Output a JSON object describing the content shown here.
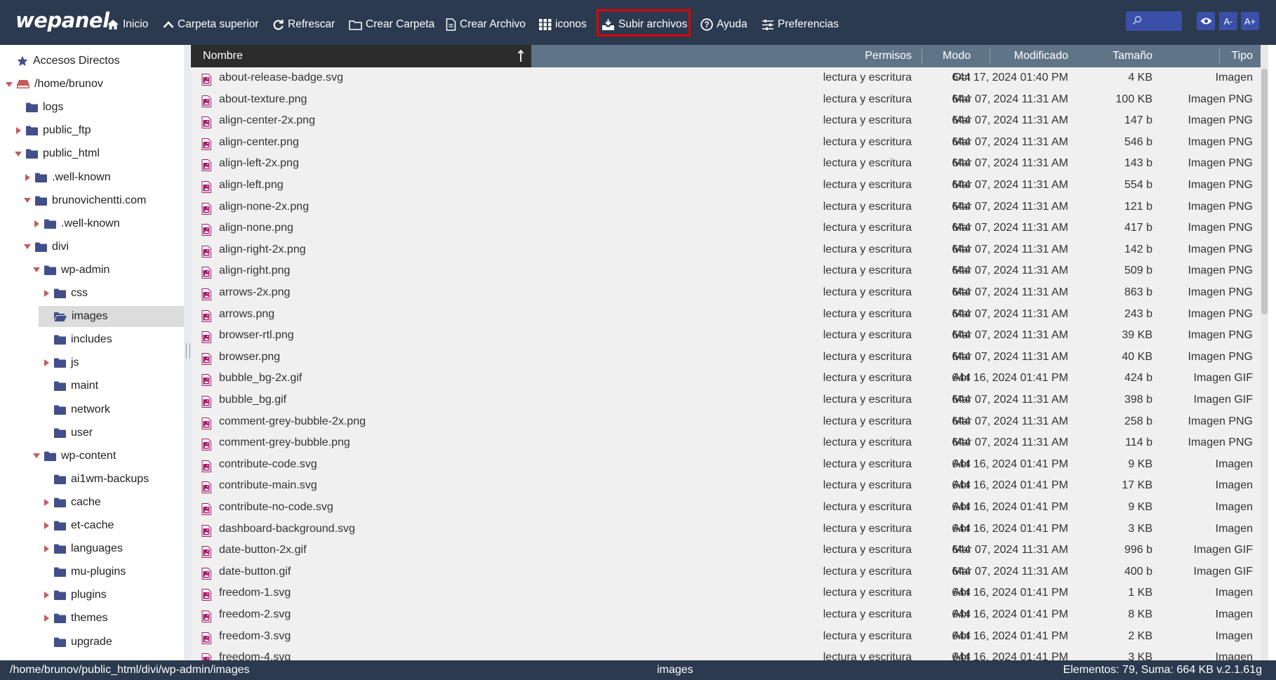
{
  "toolbar": {
    "logo": "wepanel",
    "buttons": [
      {
        "label": "Inicio",
        "icon": "home-icon"
      },
      {
        "label": "Carpeta superior",
        "icon": "chevron-up-icon"
      },
      {
        "label": "Refrescar",
        "icon": "refresh-icon"
      },
      {
        "label": "Crear Carpeta",
        "icon": "new-folder-icon"
      },
      {
        "label": "Crear Archivo",
        "icon": "new-file-icon"
      },
      {
        "label": "iconos",
        "icon": "grid-icon"
      },
      {
        "label": "Subir archivos",
        "icon": "upload-icon",
        "highlighted": true
      },
      {
        "label": "Ayuda",
        "icon": "help-icon"
      },
      {
        "label": "Preferencias",
        "icon": "sliders-icon"
      }
    ],
    "search_placeholder": "",
    "font_decrease": "A-",
    "font_increase": "A+",
    "highlight_color": "#e00000",
    "accent_color": "#3a4fa8"
  },
  "sidebar": {
    "items": [
      {
        "label": "Accesos Directos",
        "icon": "star-icon",
        "caret": "none",
        "depth": 0
      },
      {
        "label": "/home/brunov",
        "icon": "drive-icon",
        "caret": "down",
        "depth": 0
      },
      {
        "label": "logs",
        "icon": "folder-icon",
        "caret": "none",
        "depth": 1
      },
      {
        "label": "public_ftp",
        "icon": "folder-icon",
        "caret": "right",
        "depth": 1
      },
      {
        "label": "public_html",
        "icon": "folder-icon",
        "caret": "down",
        "depth": 1
      },
      {
        "label": ".well-known",
        "icon": "folder-icon",
        "caret": "right",
        "depth": 2
      },
      {
        "label": "brunovichentti.com",
        "icon": "folder-icon",
        "caret": "down",
        "depth": 2
      },
      {
        "label": ".well-known",
        "icon": "folder-icon",
        "caret": "right",
        "depth": 3
      },
      {
        "label": "divi",
        "icon": "folder-icon",
        "caret": "down",
        "depth": 2
      },
      {
        "label": "wp-admin",
        "icon": "folder-icon",
        "caret": "down",
        "depth": 3
      },
      {
        "label": "css",
        "icon": "folder-icon",
        "caret": "right",
        "depth": 4
      },
      {
        "label": "images",
        "icon": "open-folder-icon",
        "caret": "none",
        "depth": 4,
        "selected": true
      },
      {
        "label": "includes",
        "icon": "folder-icon",
        "caret": "none",
        "depth": 4
      },
      {
        "label": "js",
        "icon": "folder-icon",
        "caret": "right",
        "depth": 4
      },
      {
        "label": "maint",
        "icon": "folder-icon",
        "caret": "none",
        "depth": 4
      },
      {
        "label": "network",
        "icon": "folder-icon",
        "caret": "none",
        "depth": 4
      },
      {
        "label": "user",
        "icon": "folder-icon",
        "caret": "none",
        "depth": 4
      },
      {
        "label": "wp-content",
        "icon": "folder-icon",
        "caret": "down",
        "depth": 3
      },
      {
        "label": "ai1wm-backups",
        "icon": "folder-icon",
        "caret": "none",
        "depth": 4
      },
      {
        "label": "cache",
        "icon": "folder-icon",
        "caret": "right",
        "depth": 4
      },
      {
        "label": "et-cache",
        "icon": "folder-icon",
        "caret": "right",
        "depth": 4
      },
      {
        "label": "languages",
        "icon": "folder-icon",
        "caret": "right",
        "depth": 4
      },
      {
        "label": "mu-plugins",
        "icon": "folder-icon",
        "caret": "none",
        "depth": 4
      },
      {
        "label": "plugins",
        "icon": "folder-icon",
        "caret": "right",
        "depth": 4
      },
      {
        "label": "themes",
        "icon": "folder-icon",
        "caret": "right",
        "depth": 4
      },
      {
        "label": "upgrade",
        "icon": "folder-icon",
        "caret": "none",
        "depth": 4
      }
    ]
  },
  "table": {
    "columns": {
      "name": "Nombre",
      "perms": "Permisos",
      "mode": "Modo",
      "modified": "Modificado",
      "size": "Tamaño",
      "type": "Tipo"
    },
    "sort_icon": "sort-asc-icon",
    "rows": [
      {
        "name": "about-release-badge.svg",
        "perms": "lectura y escritura",
        "mode": "644",
        "modified": "Oct 17, 2024 01:40 PM",
        "size": "4 KB",
        "type": "Imagen"
      },
      {
        "name": "about-texture.png",
        "perms": "lectura y escritura",
        "mode": "644",
        "modified": "Mar 07, 2024 11:31 AM",
        "size": "100 KB",
        "type": "Imagen PNG"
      },
      {
        "name": "align-center-2x.png",
        "perms": "lectura y escritura",
        "mode": "644",
        "modified": "Mar 07, 2024 11:31 AM",
        "size": "147 b",
        "type": "Imagen PNG"
      },
      {
        "name": "align-center.png",
        "perms": "lectura y escritura",
        "mode": "644",
        "modified": "Mar 07, 2024 11:31 AM",
        "size": "546 b",
        "type": "Imagen PNG"
      },
      {
        "name": "align-left-2x.png",
        "perms": "lectura y escritura",
        "mode": "644",
        "modified": "Mar 07, 2024 11:31 AM",
        "size": "143 b",
        "type": "Imagen PNG"
      },
      {
        "name": "align-left.png",
        "perms": "lectura y escritura",
        "mode": "644",
        "modified": "Mar 07, 2024 11:31 AM",
        "size": "554 b",
        "type": "Imagen PNG"
      },
      {
        "name": "align-none-2x.png",
        "perms": "lectura y escritura",
        "mode": "644",
        "modified": "Mar 07, 2024 11:31 AM",
        "size": "121 b",
        "type": "Imagen PNG"
      },
      {
        "name": "align-none.png",
        "perms": "lectura y escritura",
        "mode": "644",
        "modified": "Mar 07, 2024 11:31 AM",
        "size": "417 b",
        "type": "Imagen PNG"
      },
      {
        "name": "align-right-2x.png",
        "perms": "lectura y escritura",
        "mode": "644",
        "modified": "Mar 07, 2024 11:31 AM",
        "size": "142 b",
        "type": "Imagen PNG"
      },
      {
        "name": "align-right.png",
        "perms": "lectura y escritura",
        "mode": "644",
        "modified": "Mar 07, 2024 11:31 AM",
        "size": "509 b",
        "type": "Imagen PNG"
      },
      {
        "name": "arrows-2x.png",
        "perms": "lectura y escritura",
        "mode": "644",
        "modified": "Mar 07, 2024 11:31 AM",
        "size": "863 b",
        "type": "Imagen PNG"
      },
      {
        "name": "arrows.png",
        "perms": "lectura y escritura",
        "mode": "644",
        "modified": "Mar 07, 2024 11:31 AM",
        "size": "243 b",
        "type": "Imagen PNG"
      },
      {
        "name": "browser-rtl.png",
        "perms": "lectura y escritura",
        "mode": "644",
        "modified": "Mar 07, 2024 11:31 AM",
        "size": "39 KB",
        "type": "Imagen PNG"
      },
      {
        "name": "browser.png",
        "perms": "lectura y escritura",
        "mode": "644",
        "modified": "Mar 07, 2024 11:31 AM",
        "size": "40 KB",
        "type": "Imagen PNG"
      },
      {
        "name": "bubble_bg-2x.gif",
        "perms": "lectura y escritura",
        "mode": "644",
        "modified": "Abr 16, 2024 01:41 PM",
        "size": "424 b",
        "type": "Imagen GIF"
      },
      {
        "name": "bubble_bg.gif",
        "perms": "lectura y escritura",
        "mode": "644",
        "modified": "Mar 07, 2024 11:31 AM",
        "size": "398 b",
        "type": "Imagen GIF"
      },
      {
        "name": "comment-grey-bubble-2x.png",
        "perms": "lectura y escritura",
        "mode": "644",
        "modified": "Mar 07, 2024 11:31 AM",
        "size": "258 b",
        "type": "Imagen PNG"
      },
      {
        "name": "comment-grey-bubble.png",
        "perms": "lectura y escritura",
        "mode": "644",
        "modified": "Mar 07, 2024 11:31 AM",
        "size": "114 b",
        "type": "Imagen PNG"
      },
      {
        "name": "contribute-code.svg",
        "perms": "lectura y escritura",
        "mode": "644",
        "modified": "Abr 16, 2024 01:41 PM",
        "size": "9 KB",
        "type": "Imagen"
      },
      {
        "name": "contribute-main.svg",
        "perms": "lectura y escritura",
        "mode": "644",
        "modified": "Abr 16, 2024 01:41 PM",
        "size": "17 KB",
        "type": "Imagen"
      },
      {
        "name": "contribute-no-code.svg",
        "perms": "lectura y escritura",
        "mode": "644",
        "modified": "Abr 16, 2024 01:41 PM",
        "size": "9 KB",
        "type": "Imagen"
      },
      {
        "name": "dashboard-background.svg",
        "perms": "lectura y escritura",
        "mode": "644",
        "modified": "Abr 16, 2024 01:41 PM",
        "size": "3 KB",
        "type": "Imagen"
      },
      {
        "name": "date-button-2x.gif",
        "perms": "lectura y escritura",
        "mode": "644",
        "modified": "Mar 07, 2024 11:31 AM",
        "size": "996 b",
        "type": "Imagen GIF"
      },
      {
        "name": "date-button.gif",
        "perms": "lectura y escritura",
        "mode": "644",
        "modified": "Mar 07, 2024 11:31 AM",
        "size": "400 b",
        "type": "Imagen GIF"
      },
      {
        "name": "freedom-1.svg",
        "perms": "lectura y escritura",
        "mode": "644",
        "modified": "Abr 16, 2024 01:41 PM",
        "size": "1 KB",
        "type": "Imagen"
      },
      {
        "name": "freedom-2.svg",
        "perms": "lectura y escritura",
        "mode": "644",
        "modified": "Abr 16, 2024 01:41 PM",
        "size": "8 KB",
        "type": "Imagen"
      },
      {
        "name": "freedom-3.svg",
        "perms": "lectura y escritura",
        "mode": "644",
        "modified": "Abr 16, 2024 01:41 PM",
        "size": "2 KB",
        "type": "Imagen"
      },
      {
        "name": "freedom-4.svg",
        "perms": "lectura y escritura",
        "mode": "644",
        "modified": "Abr 16, 2024 01:41 PM",
        "size": "3 KB",
        "type": "Imagen"
      }
    ]
  },
  "statusbar": {
    "path": "/home/brunov/public_html/divi/wp-admin/images",
    "current": "images",
    "info": "Elementos: 79, Suma: 664 KB v.2.1.61g"
  }
}
